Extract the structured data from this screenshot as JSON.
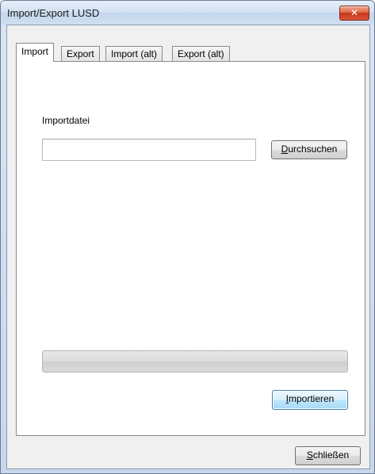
{
  "window": {
    "title": "Import/Export LUSD",
    "close_symbol": "✕",
    "close_icon": "close-icon"
  },
  "tabs": [
    {
      "label": "Import",
      "active": true
    },
    {
      "label": "Export",
      "active": false
    },
    {
      "label": "Import (alt)",
      "active": false
    },
    {
      "label": "Export (alt)",
      "active": false
    }
  ],
  "import_panel": {
    "file_label": "Importdatei",
    "file_value": "",
    "browse_button": {
      "prefix": "",
      "mnemonic": "D",
      "rest": "urchsuchen"
    },
    "progress": 0,
    "import_button": {
      "prefix": "",
      "mnemonic": "I",
      "rest": "mportieren"
    }
  },
  "footer": {
    "close_button": {
      "prefix": "",
      "mnemonic": "S",
      "rest": "chließen"
    }
  }
}
